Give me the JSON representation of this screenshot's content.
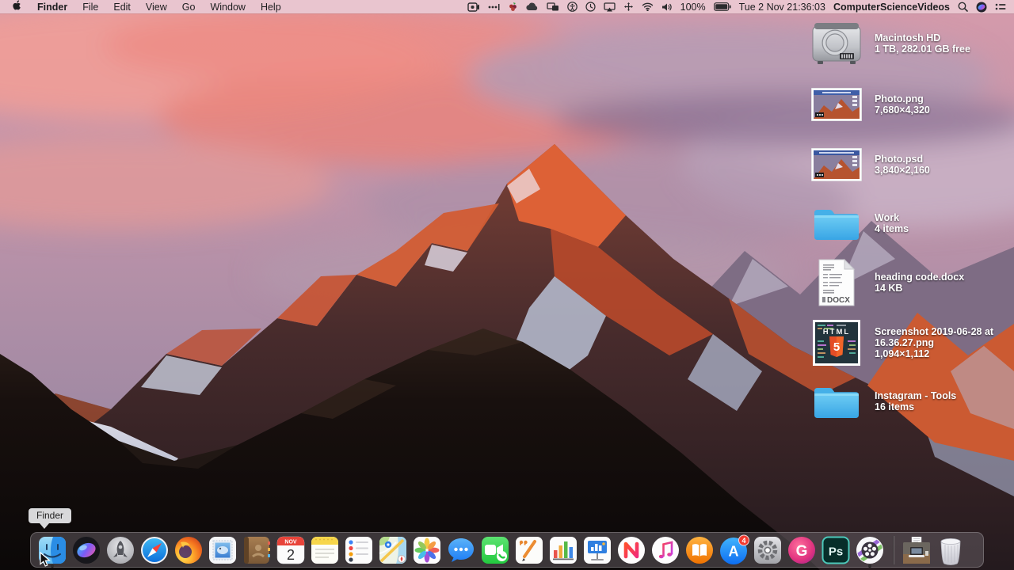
{
  "menu_bar": {
    "apple_icon": "apple-logo",
    "active_app": "Finder",
    "menus": [
      "File",
      "Edit",
      "View",
      "Go",
      "Window",
      "Help"
    ],
    "status_icons": [
      "screen-recording",
      "input-dots",
      "grapes",
      "cloud",
      "displays",
      "accessibility",
      "time-machine",
      "airplay",
      "move-arrows",
      "wifi",
      "volume"
    ],
    "status": {
      "battery": "100%",
      "clock": "Tue 2 Nov 21:36:03",
      "user": "ComputerScienceVideos"
    },
    "right_icons": [
      "spotlight",
      "siri",
      "notification-center"
    ]
  },
  "desktop": {
    "items": [
      {
        "kind": "hard-drive",
        "name": "Macintosh HD",
        "meta": "1 TB, 282.01 GB free"
      },
      {
        "kind": "image-file",
        "name": "Photo.png",
        "meta": "7,680×4,320"
      },
      {
        "kind": "image-file",
        "name": "Photo.psd",
        "meta": "3,840×2,160"
      },
      {
        "kind": "folder",
        "name": "Work",
        "meta": "4 items"
      },
      {
        "kind": "word-document",
        "name": "heading code.docx",
        "meta": "14 KB",
        "badge": "DOCX"
      },
      {
        "kind": "screenshot-image",
        "name_line1": "Screenshot 2019-06-28 at",
        "name_line2": "16.36.27.png",
        "meta": "1,094×1,112",
        "thumb_word": "HTML",
        "thumb_num": "5"
      },
      {
        "kind": "folder",
        "name": "Instagram - Tools",
        "meta": "16 items"
      }
    ]
  },
  "dock": {
    "tooltip": "Finder",
    "items": [
      "finder",
      "siri",
      "launchpad",
      "safari",
      "firefox",
      "mail",
      "contacts",
      "calendar",
      "notes",
      "reminders",
      "maps",
      "photos",
      "messages",
      "facetime",
      "pages",
      "numbers",
      "keynote",
      "news",
      "music",
      "books",
      "app-store",
      "system-preferences",
      "g-app",
      "photoshop",
      "video-player",
      "separator",
      "minimized-window",
      "trash"
    ],
    "running_apps": [
      "finder",
      "video-player"
    ],
    "badges": {
      "app_store": "4"
    },
    "calendar": {
      "month": "NOV",
      "day": "2"
    },
    "glyphs": {
      "app_store": "A",
      "g_app": "G",
      "photoshop": "Ps"
    }
  },
  "colors": {
    "menu_bar_tint": "#ebc7d1",
    "dock_tint": "rgba(104,96,102,0.52)",
    "folder_blue": "#4db5ec",
    "badge_red": "#f03b30"
  }
}
